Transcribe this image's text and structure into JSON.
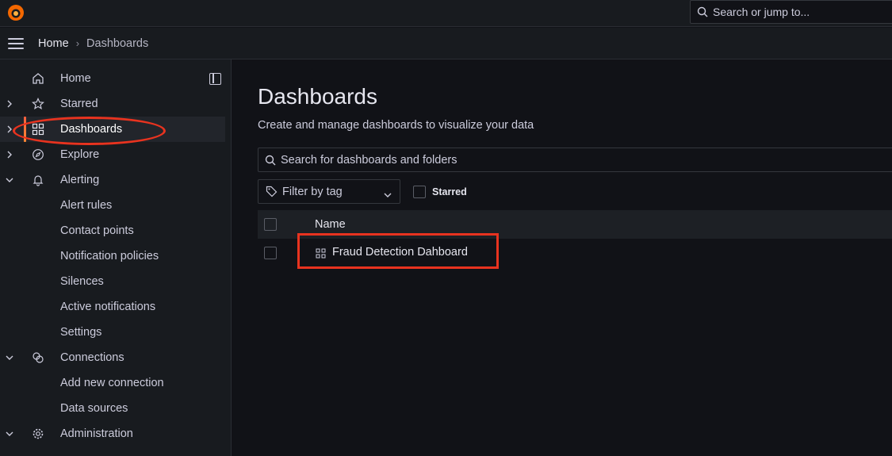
{
  "topbar": {
    "logo_icon": "grafana-logo-icon",
    "search_placeholder": "Search or jump to..."
  },
  "breadcrumb": {
    "home": "Home",
    "separator": "›",
    "current": "Dashboards"
  },
  "sidebar": {
    "items": [
      {
        "label": "Home",
        "icon": "home-icon"
      },
      {
        "label": "Starred",
        "icon": "star-icon"
      },
      {
        "label": "Dashboards",
        "icon": "apps-icon",
        "active": true
      },
      {
        "label": "Explore",
        "icon": "compass-icon"
      },
      {
        "label": "Alerting",
        "icon": "bell-icon"
      },
      {
        "label": "Alert rules"
      },
      {
        "label": "Contact points"
      },
      {
        "label": "Notification policies"
      },
      {
        "label": "Silences"
      },
      {
        "label": "Active notifications"
      },
      {
        "label": "Settings"
      },
      {
        "label": "Connections",
        "icon": "connections-icon"
      },
      {
        "label": "Add new connection"
      },
      {
        "label": "Data sources"
      },
      {
        "label": "Administration",
        "icon": "cog-icon"
      }
    ]
  },
  "main": {
    "title": "Dashboards",
    "subtitle": "Create and manage dashboards to visualize your data",
    "search_placeholder": "Search for dashboards and folders",
    "tag_filter": "Filter by tag",
    "starred_label": "Starred",
    "table": {
      "column_name": "Name",
      "rows": [
        {
          "name": "Fraud Detection Dahboard",
          "icon": "apps-icon"
        }
      ]
    }
  },
  "colors": {
    "accent": "#f55f3e",
    "annotation": "#e8331f",
    "background": "#111217",
    "panel": "#181b1f"
  }
}
